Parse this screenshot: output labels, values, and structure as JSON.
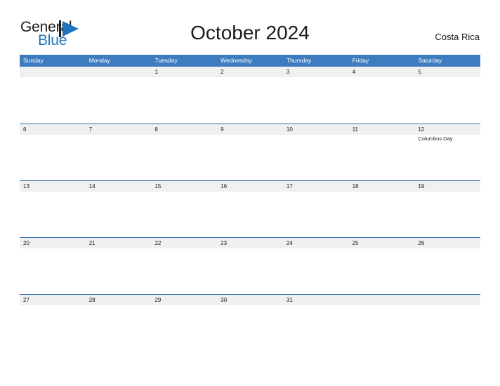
{
  "brand": {
    "name_part1": "General",
    "name_part2": "Blue",
    "mark": "triangle-flag-icon",
    "accent_color": "#1f74bd"
  },
  "header": {
    "title": "October 2024",
    "region": "Costa Rica"
  },
  "calendar": {
    "month": "October",
    "year": "2024",
    "header_color": "#3c7cbf",
    "strip_color": "#eff0f0",
    "rule_color": "#2a6ab0",
    "weekdays": [
      "Sunday",
      "Monday",
      "Tuesday",
      "Wednesday",
      "Thursday",
      "Friday",
      "Saturday"
    ],
    "weeks": [
      [
        {
          "day": ""
        },
        {
          "day": ""
        },
        {
          "day": "1"
        },
        {
          "day": "2"
        },
        {
          "day": "3"
        },
        {
          "day": "4"
        },
        {
          "day": "5"
        }
      ],
      [
        {
          "day": "6"
        },
        {
          "day": "7"
        },
        {
          "day": "8"
        },
        {
          "day": "9"
        },
        {
          "day": "10"
        },
        {
          "day": "11"
        },
        {
          "day": "12",
          "event": "Columbus Day"
        }
      ],
      [
        {
          "day": "13"
        },
        {
          "day": "14"
        },
        {
          "day": "15"
        },
        {
          "day": "16"
        },
        {
          "day": "17"
        },
        {
          "day": "18"
        },
        {
          "day": "19"
        }
      ],
      [
        {
          "day": "20"
        },
        {
          "day": "21"
        },
        {
          "day": "22"
        },
        {
          "day": "23"
        },
        {
          "day": "24"
        },
        {
          "day": "25"
        },
        {
          "day": "26"
        }
      ],
      [
        {
          "day": "27"
        },
        {
          "day": "28"
        },
        {
          "day": "29"
        },
        {
          "day": "30"
        },
        {
          "day": "31"
        },
        {
          "day": ""
        },
        {
          "day": ""
        }
      ]
    ]
  }
}
